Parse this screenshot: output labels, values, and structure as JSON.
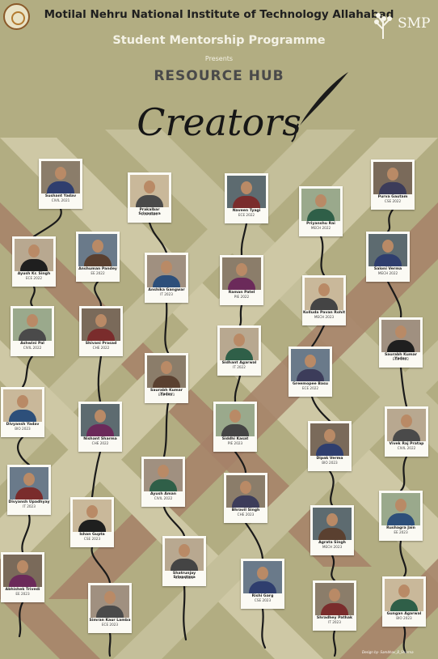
{
  "header": {
    "institute": "Motilal Nehru National Institute of Technology Allahabad",
    "programme": "Student Mentorship Programme",
    "presents": "Presents",
    "resource_hub": "RESOURCE HUB",
    "creators": "Creators"
  },
  "logo": {
    "smp_text": "SMP"
  },
  "colors": {
    "background": "#b2ad82",
    "stripe_light": "#d2cca9",
    "stripe_dark": "#a47c66",
    "thread": "#1a1a1a"
  },
  "creators": [
    {
      "name": "Sushant Yadav",
      "dept": "CIVIL 2021"
    },
    {
      "name": "Prakalbar Srivastava",
      "dept": "ECE 2020"
    },
    {
      "name": "Naveen Tyagi",
      "dept": "ECE 2022"
    },
    {
      "name": "Priyanshu Rai",
      "dept": "MECH 2022"
    },
    {
      "name": "Purva Gautam",
      "dept": "CSE 2022"
    },
    {
      "name": "Ayush Kr. Singh",
      "dept": "ECE 2022"
    },
    {
      "name": "Anshuman Pandey",
      "dept": "EE 2022"
    },
    {
      "name": "Anshika Gangwar",
      "dept": "IT 2023"
    },
    {
      "name": "Raman Patel",
      "dept": "PIE 2022"
    },
    {
      "name": "Kolluda Pavan Rohit",
      "dept": "MECH 2023"
    },
    {
      "name": "Saloni Verma",
      "dept": "MECH 2022"
    },
    {
      "name": "Ashwini Pal",
      "dept": "CIVIL 2022"
    },
    {
      "name": "Shivani Prasad",
      "dept": "CHE 2022"
    },
    {
      "name": "Sidhant Agarwal",
      "dept": "IT 2022"
    },
    {
      "name": "Greemopee Basu",
      "dept": "ECE 2022"
    },
    {
      "name": "Saurabh Kumar Yadav",
      "dept": "ECE 2022"
    },
    {
      "name": "Saurabh Kumar Yadav",
      "dept": "ECE 2023"
    },
    {
      "name": "Divyansh Yadav",
      "dept": "BIO 2023"
    },
    {
      "name": "Nishant Sharma",
      "dept": "CHE 2022"
    },
    {
      "name": "Siddhi Kasat",
      "dept": "PIE 2023"
    },
    {
      "name": "Dipak Verma",
      "dept": "BIO 2023"
    },
    {
      "name": "Vivek Raj Pratap",
      "dept": "CIVIL 2022"
    },
    {
      "name": "Divyansh Upadhyay",
      "dept": "IT 2023"
    },
    {
      "name": "Ayush Aman",
      "dept": "CIVIL 2022"
    },
    {
      "name": "Bhravil Singh",
      "dept": "CHE 2023"
    },
    {
      "name": "Ishan Gupta",
      "dept": "CSE 2023"
    },
    {
      "name": "Agrata Singh",
      "dept": "MECH 2023"
    },
    {
      "name": "Rushagra Jain",
      "dept": "EE 2023"
    },
    {
      "name": "Abhishek Trivedi",
      "dept": "EE 2023"
    },
    {
      "name": "Shatrunjay Srivastava",
      "dept": "CIVIL 2023"
    },
    {
      "name": "Rishi Garg",
      "dept": "CSE 2023"
    },
    {
      "name": "Simran Kaur Lamba",
      "dept": "ECE 2023"
    },
    {
      "name": "Shradhey Pathak",
      "dept": "IT 2023"
    },
    {
      "name": "Gungan Agarwal",
      "dept": "BIO 2023"
    }
  ],
  "credit": "Design by- Sambhav_B_Sharma"
}
